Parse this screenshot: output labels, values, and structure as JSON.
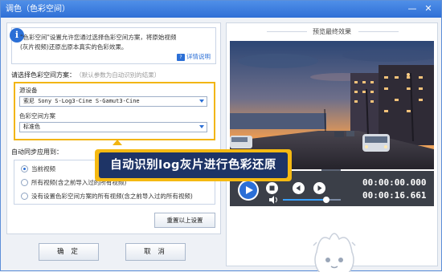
{
  "window": {
    "title": "调色（色彩空间）",
    "minimize_label": "—",
    "close_label": "✕"
  },
  "info": {
    "line1": "\"色彩空间\"设置允许您通过选择色彩空间方案，将原始视频",
    "line2": "(灰片视频)还原出原本真实的色彩效果。",
    "detail_link": "详情说明"
  },
  "scheme": {
    "label": "请选择色彩空间方案：",
    "hint": "（默认参数为自动识别的结果）",
    "device_label": "源设备",
    "device_value": "索尼 Sony S-Log3-Cine S-Gamut3-Cine",
    "space_label": "色彩空间方案",
    "space_value": "标准色"
  },
  "sync": {
    "label": "自动同步应用到：",
    "options": [
      {
        "label": "当前视频",
        "selected": true
      },
      {
        "label": "所有视频(含之前导入过的所有视频)",
        "selected": false
      },
      {
        "label": "没有设置色彩空间方案的所有视频(含之前导入过的所有视频)",
        "selected": false
      }
    ],
    "reset_label": "重置以上设置"
  },
  "buttons": {
    "ok": "确 定",
    "cancel": "取 消"
  },
  "preview": {
    "title": "预览最终效果",
    "current_time": "00:00:00.000",
    "total_time": "00:00:16.661",
    "volume": 0.75
  },
  "callout": {
    "text": "自动识别log灰片进行色彩还原"
  },
  "colors": {
    "accent": "#2b6fd6",
    "highlight": "#f2b511",
    "callout_bg": "#1e3466"
  }
}
